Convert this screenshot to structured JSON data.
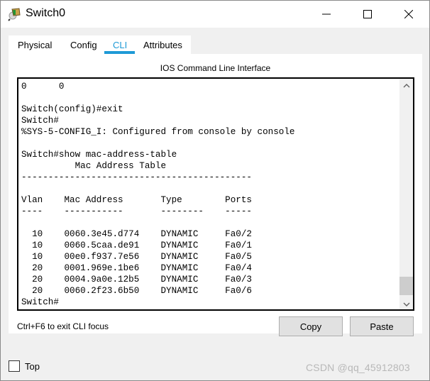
{
  "window": {
    "title": "Switch0",
    "icon": "switch-device-icon",
    "controls": {
      "minimize": "minimize-icon",
      "maximize": "maximize-icon",
      "close": "close-icon"
    }
  },
  "tabs": [
    {
      "label": "Physical",
      "active": false
    },
    {
      "label": "Config",
      "active": false
    },
    {
      "label": "CLI",
      "active": true
    },
    {
      "label": "Attributes",
      "active": false
    }
  ],
  "accent_color": "#1e9ad6",
  "cli": {
    "heading": "IOS Command Line Interface",
    "lines": [
      "0      0",
      "",
      "Switch(config)#exit",
      "Switch#",
      "%SYS-5-CONFIG_I: Configured from console by console",
      "",
      "Switch#show mac-address-table",
      "          Mac Address Table",
      "-------------------------------------------",
      "",
      "Vlan    Mac Address       Type        Ports",
      "----    -----------       --------    -----",
      "",
      "  10    0060.3e45.d774    DYNAMIC     Fa0/2",
      "  10    0060.5caa.de91    DYNAMIC     Fa0/1",
      "  10    00e0.f937.7e56    DYNAMIC     Fa0/5",
      "  20    0001.969e.1be6    DYNAMIC     Fa0/4",
      "  20    0004.9a0e.12b5    DYNAMIC     Fa0/3",
      "  20    0060.2f23.6b50    DYNAMIC     Fa0/6",
      "Switch#"
    ],
    "mac_table": {
      "title": "Mac Address Table",
      "columns": [
        "Vlan",
        "Mac Address",
        "Type",
        "Ports"
      ],
      "rows": [
        [
          "10",
          "0060.3e45.d774",
          "DYNAMIC",
          "Fa0/2"
        ],
        [
          "10",
          "0060.5caa.de91",
          "DYNAMIC",
          "Fa0/1"
        ],
        [
          "10",
          "00e0.f937.7e56",
          "DYNAMIC",
          "Fa0/5"
        ],
        [
          "20",
          "0001.969e.1be6",
          "DYNAMIC",
          "Fa0/4"
        ],
        [
          "20",
          "0004.9a0e.12b5",
          "DYNAMIC",
          "Fa0/3"
        ],
        [
          "20",
          "0060.2f23.6b50",
          "DYNAMIC",
          "Fa0/6"
        ]
      ]
    },
    "scroll_position_fraction": 1.0
  },
  "footer": {
    "hint": "Ctrl+F6 to exit CLI focus",
    "copy_label": "Copy",
    "paste_label": "Paste"
  },
  "bottom": {
    "top_label": "Top",
    "top_checked": false,
    "watermark": "CSDN @qq_45912803"
  }
}
